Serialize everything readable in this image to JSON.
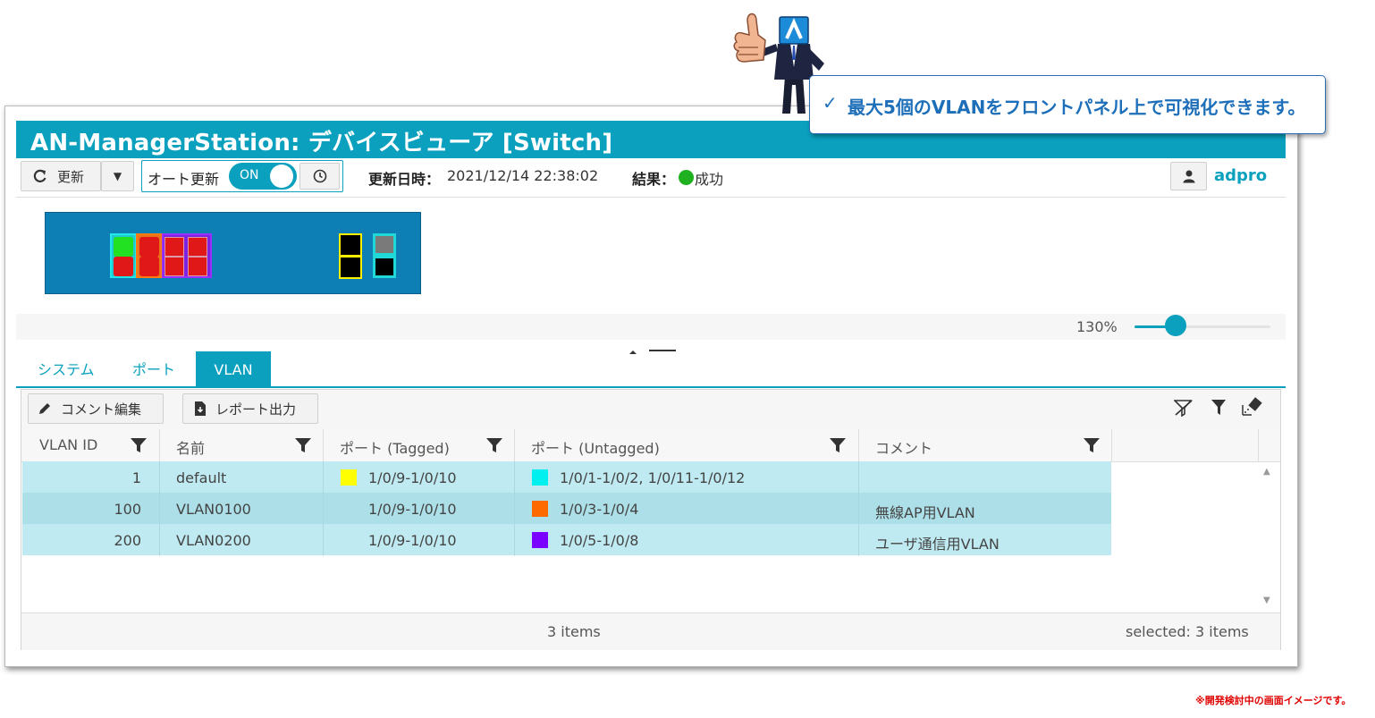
{
  "window": {
    "title": "AN-ManagerStation: デバイスビューア [Switch]"
  },
  "toolbar": {
    "refresh_label": "更新",
    "auto_refresh_label": "オート更新",
    "toggle_state": "ON",
    "updated_label": "更新日時：",
    "updated_value": "2021/12/14 22:38:02",
    "result_label": "結果：",
    "result_value": "成功",
    "user_name": "adpro"
  },
  "device": {
    "zoom_label": "130%",
    "zoom_level": 0.3
  },
  "tabs": [
    {
      "label": "システム",
      "active": false
    },
    {
      "label": "ポート",
      "active": false
    },
    {
      "label": "VLAN",
      "active": true
    }
  ],
  "grid": {
    "actions": {
      "comment_edit": "コメント編集",
      "report_output": "レポート出力"
    },
    "columns": [
      "VLAN ID",
      "名前",
      "ポート (Tagged)",
      "ポート (Untagged)",
      "コメント"
    ],
    "rows": [
      {
        "id": "1",
        "name": "default",
        "tagged": "1/0/9-1/0/10",
        "untagged": "1/0/1-1/0/2, 1/0/11-1/0/12",
        "comment": "",
        "tagged_color": "#ffff00",
        "untagged_color": "#00f0f0"
      },
      {
        "id": "100",
        "name": "VLAN0100",
        "tagged": "1/0/9-1/0/10",
        "untagged": "1/0/3-1/0/4",
        "comment": "無線AP用VLAN",
        "tagged_color": "",
        "untagged_color": "#ff6a00"
      },
      {
        "id": "200",
        "name": "VLAN0200",
        "tagged": "1/0/9-1/0/10",
        "untagged": "1/0/5-1/0/8",
        "comment": "ユーザ通信用VLAN",
        "tagged_color": "",
        "untagged_color": "#7a00ff"
      }
    ],
    "footer": {
      "count": "3 items",
      "selected": "selected: 3 items"
    }
  },
  "callout": {
    "check": "✓",
    "text": "最大5個のVLANをフロントパネル上で可視化できます。"
  },
  "note": "※開発検討中の画面イメージです。",
  "colors": {
    "accent": "#0aa0be",
    "panel": "#0e7fb5",
    "row": "#bde9f0",
    "callout_text": "#1e6fb9"
  }
}
